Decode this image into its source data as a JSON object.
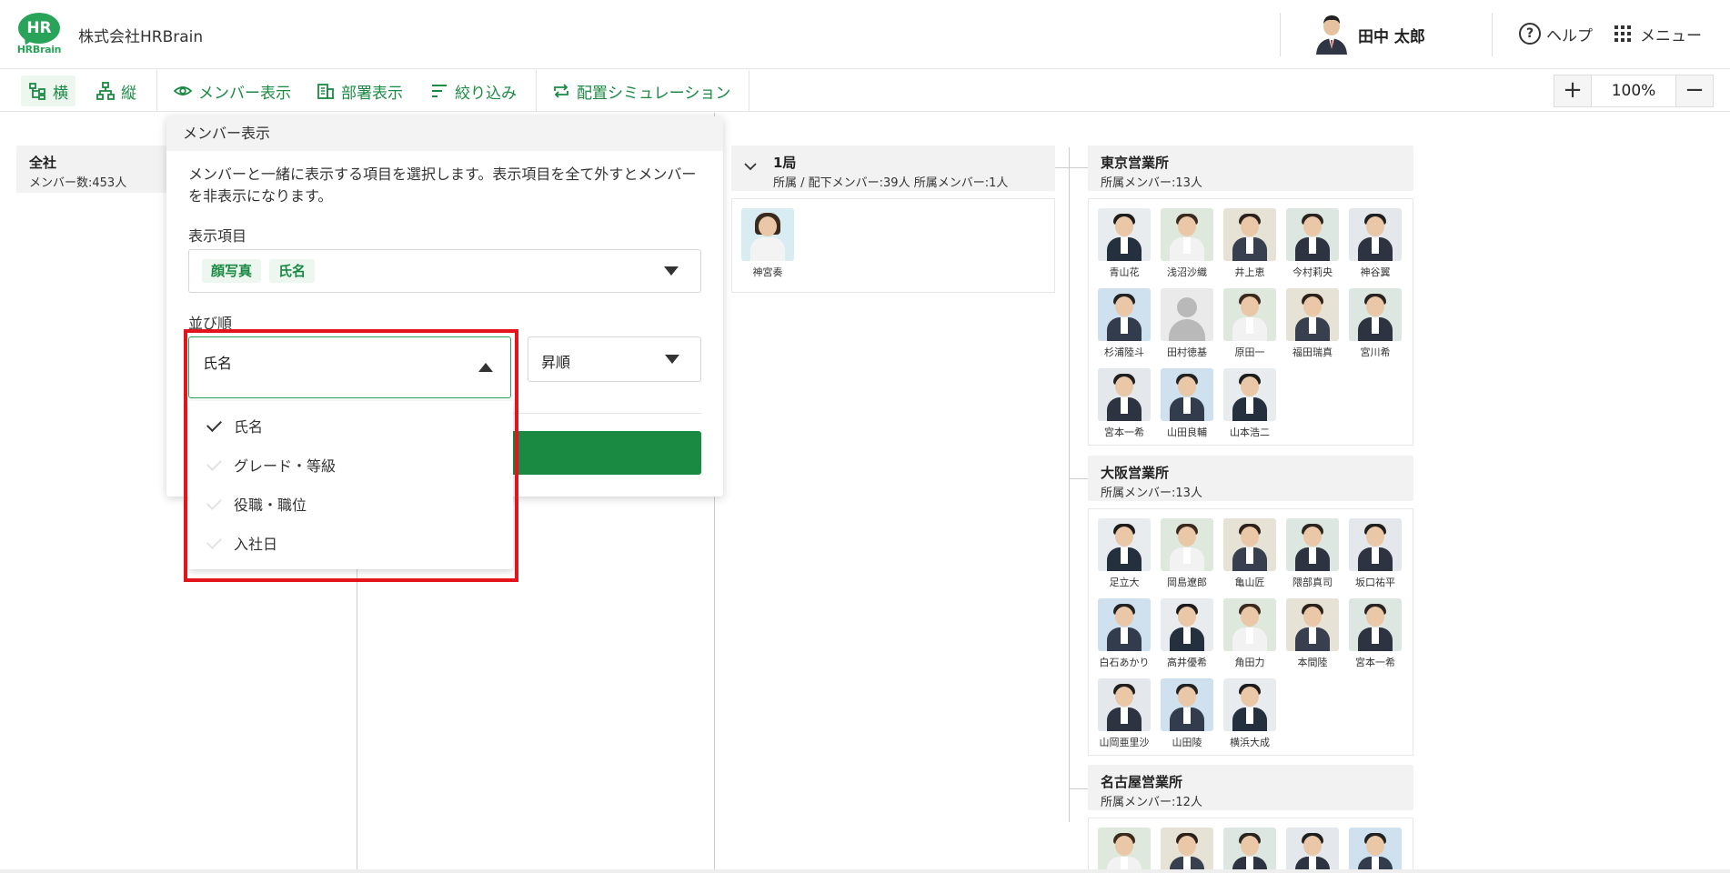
{
  "header": {
    "company": "株式会社HRBrain",
    "logo_text": "HR",
    "logo_sub": "HRBrain",
    "user_name": "田中 太郎",
    "help_label": "ヘルプ",
    "menu_label": "メニュー"
  },
  "toolbar": {
    "horizontal": "横",
    "vertical": "縦",
    "member_display": "メンバー表示",
    "dept_display": "部署表示",
    "filter": "絞り込み",
    "simulation": "配置シミュレーション",
    "zoom": "100%"
  },
  "org": {
    "root": {
      "title": "全社",
      "sub": "メンバー数:453人"
    },
    "bureau": {
      "title": "1局",
      "sub": "所属 / 配下メンバー:39人 所属メンバー:1人",
      "members": [
        "神宮奏"
      ]
    },
    "tokyo": {
      "title": "東京営業所",
      "sub": "所属メンバー:13人",
      "members": [
        "青山花",
        "浅沼沙織",
        "井上恵",
        "今村莉央",
        "神谷翼",
        "杉浦陸斗",
        "田村徳基",
        "原田一",
        "福田瑞真",
        "宮川希",
        "宮本一希",
        "山田良輔",
        "山本浩二"
      ]
    },
    "osaka": {
      "title": "大阪営業所",
      "sub": "所属メンバー:13人",
      "members": [
        "足立大",
        "岡島遼郎",
        "亀山匠",
        "隈部真司",
        "坂口祐平",
        "白石あかり",
        "高井優希",
        "角田力",
        "本間陸",
        "宮本一希",
        "山岡亜里沙",
        "山田陵",
        "横浜大成"
      ]
    },
    "nagoya": {
      "title": "名古屋営業所",
      "sub": "所属メンバー:12人"
    }
  },
  "popover": {
    "title": "メンバー表示",
    "description": "メンバーと一緒に表示する項目を選択します。表示項目を全て外すとメンバーを非表示になります。",
    "display_items_label": "表示項目",
    "chips": [
      "顔写真",
      "氏名"
    ],
    "sort_label": "並び順",
    "sort_value": "氏名",
    "order_value": "昇順",
    "sort_options": [
      "氏名",
      "グレード・等級",
      "役職・職位",
      "入社日"
    ],
    "selected_option": "氏名"
  },
  "colors": {
    "accent": "#1a8a43",
    "highlight": "#e3141c"
  }
}
